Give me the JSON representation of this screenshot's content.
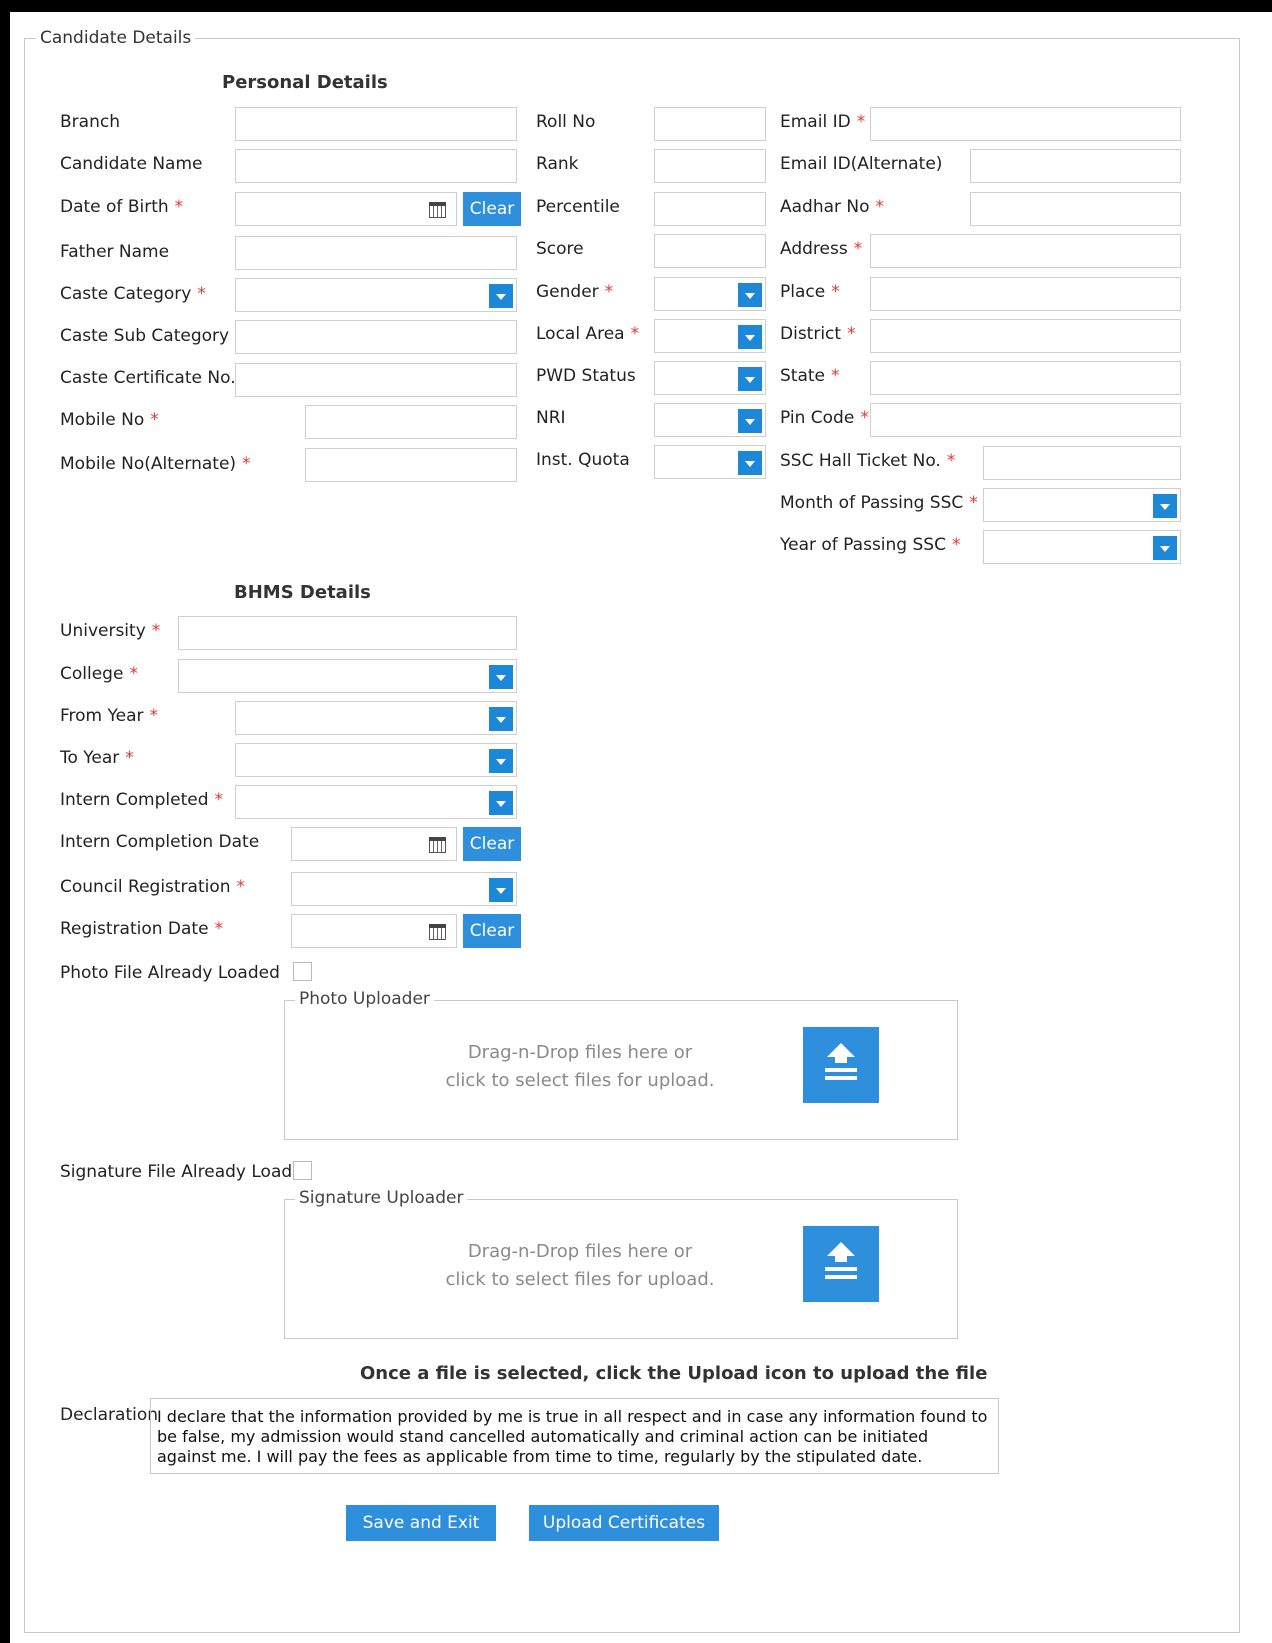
{
  "legend": "Candidate Details",
  "sections": {
    "personal": "Personal Details",
    "bhms": "BHMS Details"
  },
  "labels": {
    "branch": "Branch",
    "candidate_name": "Candidate Name",
    "dob": "Date of Birth",
    "father_name": "Father Name",
    "caste_category": "Caste Category",
    "caste_sub_category": "Caste Sub Category",
    "caste_cert": "Caste Certificate No.",
    "mobile": "Mobile No",
    "mobile_alt": "Mobile No(Alternate)",
    "roll_no": "Roll No",
    "rank": "Rank",
    "percentile": "Percentile",
    "score": "Score",
    "gender": "Gender",
    "local_area": "Local Area",
    "pwd_status": "PWD Status",
    "nri": "NRI",
    "inst_quota": "Inst. Quota",
    "email": "Email ID",
    "email_alt": "Email ID(Alternate)",
    "aadhar": "Aadhar No",
    "address": "Address",
    "place": "Place",
    "district": "District",
    "state": "State",
    "pin": "Pin Code",
    "ssc_hall": "SSC Hall Ticket No.",
    "ssc_month": "Month of Passing SSC",
    "ssc_year": "Year of Passing SSC",
    "university": "University",
    "college": "College",
    "from_year": "From Year",
    "to_year": "To Year",
    "intern_completed": "Intern Completed",
    "intern_date": "Intern Completion Date",
    "council_reg": "Council Registration",
    "reg_date": "Registration Date",
    "photo_loaded": "Photo File Already Loaded",
    "sig_loaded": "Signature File Already Loaded",
    "declaration": "Declaration"
  },
  "required_mark": "*",
  "clear_label": "Clear",
  "photo_uploader": {
    "title": "Photo Uploader",
    "line1": "Drag-n-Drop files here or",
    "line2": "click to select files for upload."
  },
  "signature_uploader": {
    "title": "Signature Uploader",
    "line1": "Drag-n-Drop files here or",
    "line2": "click to select files for upload."
  },
  "upload_note": "Once a file is selected, click the Upload icon to upload the file",
  "declaration_text": "I declare that the information provided by me is true in all respect and in case any information found to be false, my admission would stand cancelled automatically and criminal action can be initiated against me. I will pay the fees as applicable from time to time, regularly by the stipulated date.",
  "buttons": {
    "save_exit": "Save and Exit",
    "upload_certs": "Upload Certificates"
  },
  "colors": {
    "accent": "#2e8fdc",
    "required": "#e53935"
  }
}
